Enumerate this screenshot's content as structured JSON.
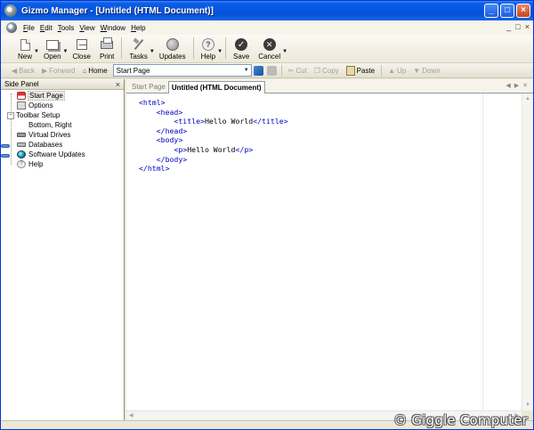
{
  "window": {
    "title": "Gizmo Manager - [Untitled (HTML Document)]",
    "minimize": "_",
    "maximize": "□",
    "close": "×"
  },
  "menu": {
    "items": [
      {
        "accel": "F",
        "rest": "ile"
      },
      {
        "accel": "E",
        "rest": "dit"
      },
      {
        "accel": "T",
        "rest": "ools"
      },
      {
        "accel": "V",
        "rest": "iew"
      },
      {
        "accel": "W",
        "rest": "indow"
      },
      {
        "accel": "H",
        "rest": "elp"
      }
    ],
    "right_controls": [
      "_",
      "□",
      "×"
    ]
  },
  "toolbar": {
    "new": "New",
    "open": "Open",
    "close": "Close",
    "print": "Print",
    "tasks": "Tasks",
    "updates": "Updates",
    "help": "Help",
    "save": "Save",
    "cancel": "Cancel"
  },
  "navbar": {
    "back": "Back",
    "forward": "Forward",
    "home": "Home",
    "address": "Start Page",
    "cut": "Cut",
    "copy": "Copy",
    "paste": "Paste",
    "up": "Up",
    "down": "Down"
  },
  "sidepanel": {
    "title": "Side Panel",
    "close": "×",
    "tree": [
      {
        "label": "Start Page",
        "selected": true
      },
      {
        "label": "Options"
      },
      {
        "label": "Toolbar Setup",
        "expander": "−"
      },
      {
        "label": "Bottom, Right"
      },
      {
        "label": "Virtual Drives"
      },
      {
        "label": "Databases"
      },
      {
        "label": "Software Updates"
      },
      {
        "label": "Help"
      }
    ]
  },
  "tabs": {
    "start": "Start Page",
    "active": "Untitled (HTML Document)"
  },
  "code_lines": [
    {
      "indent": "",
      "open": "<html>",
      "text": "",
      "close": ""
    },
    {
      "indent": "    ",
      "open": "<head>",
      "text": "",
      "close": ""
    },
    {
      "indent": "        ",
      "open": "<title>",
      "text": "Hello World",
      "close": "</title>"
    },
    {
      "indent": "    ",
      "open": "</head>",
      "text": "",
      "close": ""
    },
    {
      "indent": "    ",
      "open": "<body>",
      "text": "",
      "close": ""
    },
    {
      "indent": "        ",
      "open": "<p>",
      "text": "Hello World",
      "close": "</p>"
    },
    {
      "indent": "    ",
      "open": "</body>",
      "text": "",
      "close": ""
    },
    {
      "indent": "",
      "open": "</html>",
      "text": "",
      "close": ""
    }
  ],
  "watermark": "© Giggle Computer",
  "colors": {
    "titlebar": "#0656e2",
    "tag": "#0000c0"
  }
}
